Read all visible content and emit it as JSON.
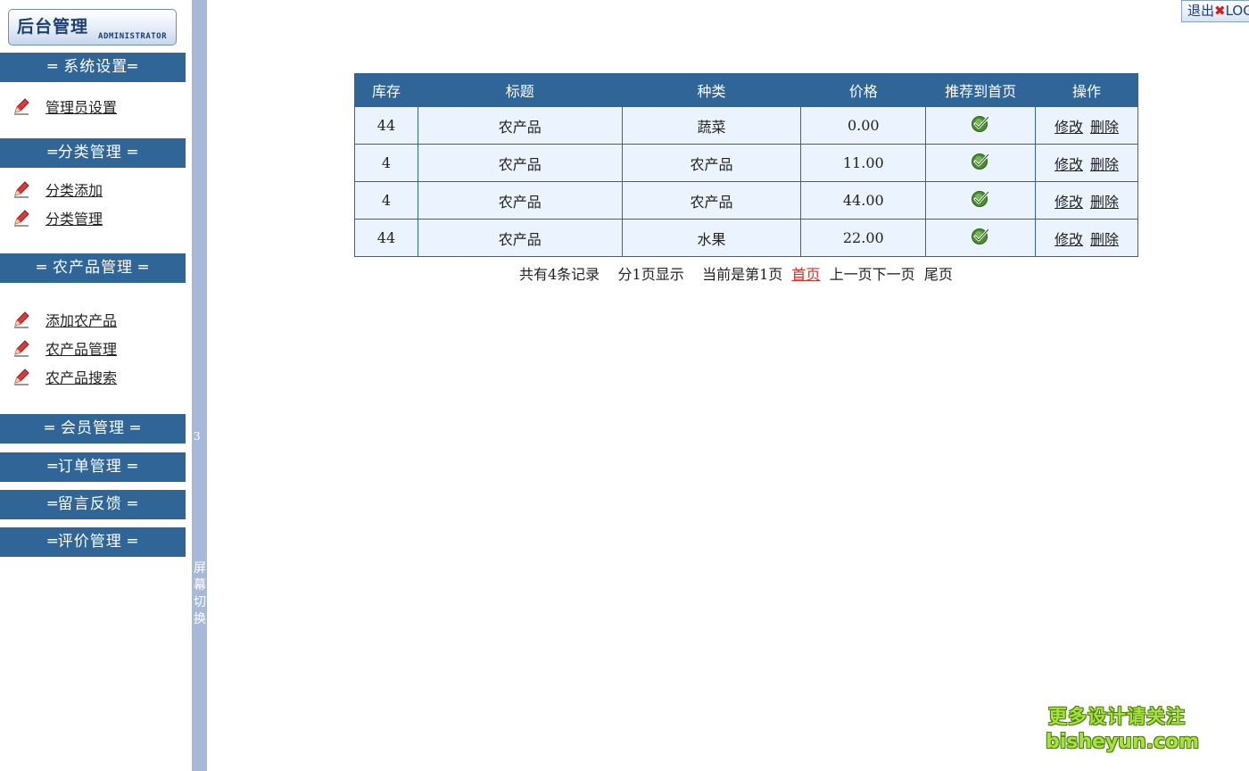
{
  "logo": {
    "title": "后台管理",
    "subtitle": "ADMINISTRATOR"
  },
  "sidebar": {
    "sections": [
      {
        "label": "═ 系统设置═",
        "items": [
          {
            "label": "管理员设置"
          }
        ]
      },
      {
        "label": "═分类管理 ═",
        "items": [
          {
            "label": "分类添加"
          },
          {
            "label": "分类管理"
          }
        ]
      },
      {
        "label": "═ 农产品管理 ═",
        "items": [
          {
            "label": "添加农产品"
          },
          {
            "label": "农产品管理"
          },
          {
            "label": "农产品搜索"
          }
        ]
      },
      {
        "label": "═ 会员管理 ═"
      },
      {
        "label": "═订单管理 ═"
      },
      {
        "label": "═留言反馈 ═"
      },
      {
        "label": "═评价管理 ═"
      }
    ]
  },
  "divider": {
    "number": "3",
    "switch": [
      "屏",
      "幕",
      "切",
      "换"
    ]
  },
  "logout": {
    "label": "退出",
    "suffix": "LOGOUT"
  },
  "table": {
    "headers": [
      "库存",
      "标题",
      "种类",
      "价格",
      "推荐到首页",
      "操作"
    ],
    "rows": [
      {
        "stock": "44",
        "title": "农产品",
        "type": "蔬菜",
        "price": "0.00"
      },
      {
        "stock": "4",
        "title": "农产品",
        "type": "农产品",
        "price": "11.00"
      },
      {
        "stock": "4",
        "title": "农产品",
        "type": "农产品",
        "price": "44.00"
      },
      {
        "stock": "44",
        "title": "农产品",
        "type": "水果",
        "price": "22.00"
      }
    ],
    "edit_label": "修改",
    "delete_label": "删除"
  },
  "pager": {
    "total": "共有4条记录",
    "pages": "分1页显示",
    "current": "当前是第1页",
    "first": "首页",
    "prev": "上一页",
    "next": "下一页",
    "last": "尾页"
  },
  "watermark": {
    "line1": "更多设计请关注",
    "line2": "bisheyun.com"
  },
  "colors": {
    "accent": "#2f6597",
    "divider": "#a7b9db",
    "row_bg": "#ebf3fe"
  },
  "icons": {
    "menu": "pencil-icon",
    "recommend": "checkmark-icon",
    "logout": "close-icon"
  }
}
